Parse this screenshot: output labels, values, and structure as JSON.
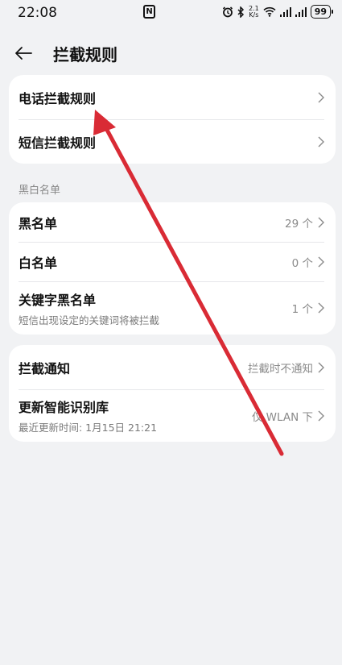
{
  "status_bar": {
    "time": "22:08",
    "nfc": "N",
    "net_speed_top": "2.1",
    "net_speed_bottom": "K/s",
    "battery": "99"
  },
  "header": {
    "title": "拦截规则"
  },
  "rules_card": {
    "items": [
      {
        "label": "电话拦截规则"
      },
      {
        "label": "短信拦截规则"
      }
    ]
  },
  "lists_section": {
    "label": "黑白名单",
    "items": [
      {
        "label": "黑名单",
        "value": "29 个"
      },
      {
        "label": "白名单",
        "value": "0 个"
      },
      {
        "label": "关键字黑名单",
        "sub": "短信出现设定的关键词将被拦截",
        "value": "1 个"
      }
    ]
  },
  "settings_card": {
    "items": [
      {
        "label": "拦截通知",
        "value": "拦截时不通知"
      },
      {
        "label": "更新智能识别库",
        "sub": "最近更新时间: 1月15日 21:21",
        "value": "仅 WLAN 下"
      }
    ]
  },
  "colors": {
    "background": "#f1f2f4",
    "card": "#ffffff",
    "annotation_arrow": "#d92b35"
  },
  "icons": [
    "back-arrow-icon",
    "chevron-right-icon",
    "alarm-icon",
    "bluetooth-icon",
    "wifi-icon",
    "signal-icon",
    "battery-icon"
  ]
}
